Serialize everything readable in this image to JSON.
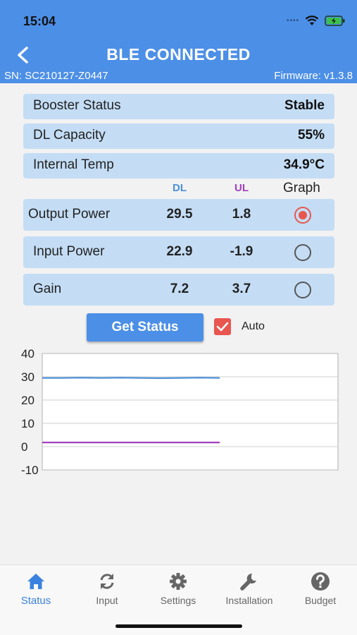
{
  "status_bar": {
    "time": "15:04"
  },
  "header": {
    "title": "BLE CONNECTED",
    "serial": "SN: SC210127-Z0447",
    "firmware": "Firmware: v1.3.8"
  },
  "info_rows": [
    {
      "label": "Booster Status",
      "value": "Stable"
    },
    {
      "label": "DL Capacity",
      "value": "55%"
    },
    {
      "label": "Internal Temp",
      "value": "34.9°C"
    }
  ],
  "table": {
    "headers": {
      "dl": "DL",
      "ul": "UL",
      "graph": "Graph"
    },
    "rows": [
      {
        "label": "Output Power",
        "dl": "29.5",
        "ul": "1.8",
        "selected": true
      },
      {
        "label": "Input Power",
        "dl": "22.9",
        "ul": "-1.9",
        "selected": false
      },
      {
        "label": "Gain",
        "dl": "7.2",
        "ul": "3.7",
        "selected": false
      }
    ]
  },
  "controls": {
    "get_status_label": "Get Status",
    "auto_label": "Auto",
    "auto_checked": true
  },
  "chart_data": {
    "type": "line",
    "ylim": [
      -10,
      40
    ],
    "yticks": [
      "40",
      "30",
      "20",
      "10",
      "0",
      "-10"
    ],
    "series": [
      {
        "color": "#4a90d9",
        "values": [
          29.5,
          29.5,
          29.6,
          29.5,
          29.6,
          29.5,
          29.4,
          29.5,
          29.6,
          29.5
        ]
      },
      {
        "color": "#a040c0",
        "values": [
          1.8,
          1.8,
          1.8,
          1.8,
          1.8,
          1.8,
          1.8,
          1.8,
          1.8,
          1.8
        ]
      }
    ]
  },
  "tabs": [
    {
      "label": "Status",
      "icon": "home-icon",
      "active": true
    },
    {
      "label": "Input",
      "icon": "refresh-icon",
      "active": false
    },
    {
      "label": "Settings",
      "icon": "gear-icon",
      "active": false
    },
    {
      "label": "Installation",
      "icon": "wrench-icon",
      "active": false
    },
    {
      "label": "Budget",
      "icon": "help-circle-icon",
      "active": false
    }
  ],
  "colors": {
    "accent": "#4c8fe6",
    "row_bg": "#c4ddf5",
    "dl": "#4a90d9",
    "ul": "#a040c0",
    "selected": "#e8564f"
  }
}
